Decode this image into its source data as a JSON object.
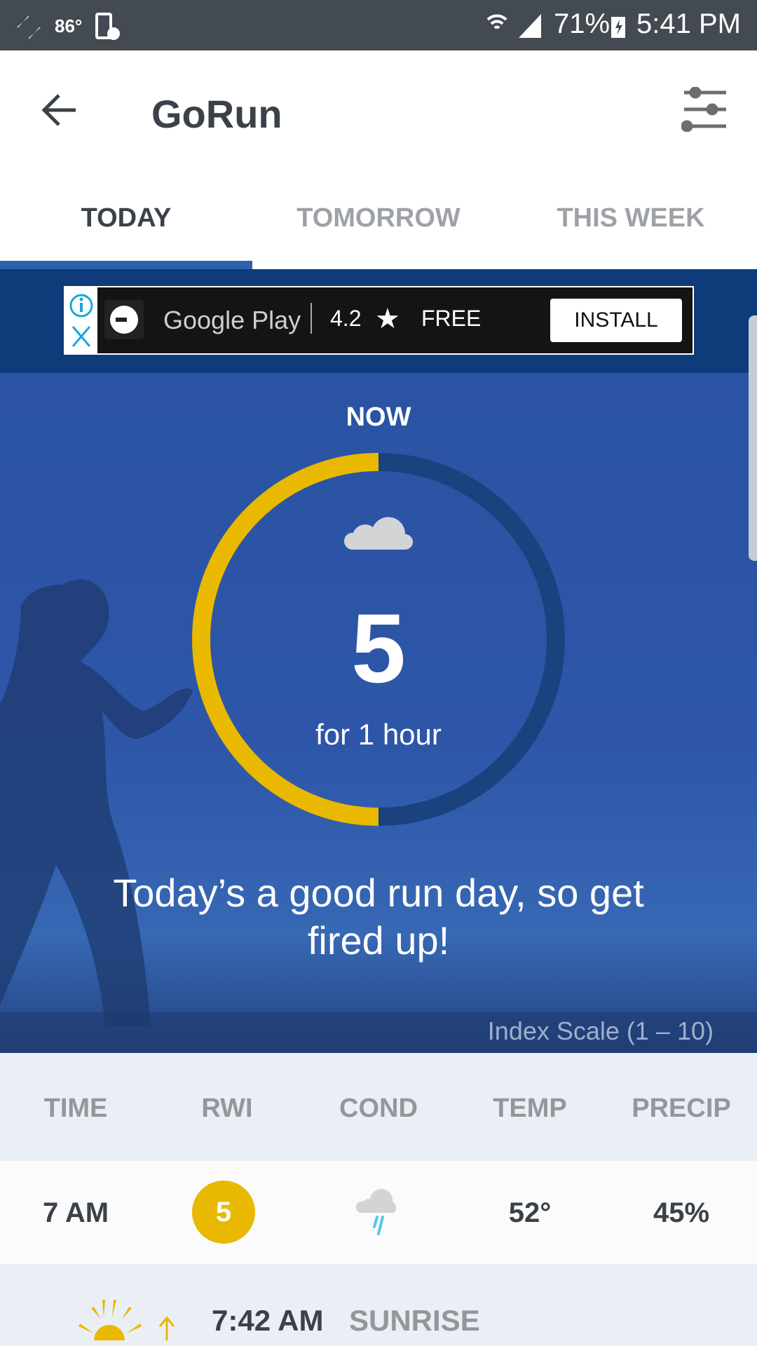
{
  "status_bar": {
    "temperature": "86°",
    "battery": "71%",
    "time": "5:41 PM"
  },
  "app_bar": {
    "title": "GoRun",
    "back_icon": "arrow-left-icon",
    "filter_icon": "sliders-icon"
  },
  "tabs": [
    {
      "label": "TODAY",
      "active": true
    },
    {
      "label": "TOMORROW",
      "active": false
    },
    {
      "label": "THIS WEEK",
      "active": false
    }
  ],
  "ad": {
    "store": "Google Play",
    "rating": "4.2",
    "price": "FREE",
    "install_label": "INSTALL"
  },
  "now": {
    "label": "NOW",
    "index": "5",
    "duration": "for 1 hour",
    "index_fraction": 0.5,
    "condition_icon": "cloud-icon",
    "message": "Today’s a good run day, so get fired up!",
    "scale_note": "Index Scale (1 – 10)"
  },
  "colors": {
    "accent": "#e9b800",
    "tab_indicator": "#2b62ad",
    "ring_track": "#1a427f"
  },
  "table": {
    "headers": [
      "TIME",
      "RWI",
      "COND",
      "TEMP",
      "PRECIP"
    ],
    "rows": [
      {
        "time": "7 AM",
        "rwi": "5",
        "cond": "rain-cloud-icon",
        "temp": "52°",
        "precip": "45%"
      }
    ]
  },
  "sunrise": {
    "time": "7:42 AM",
    "label": "SUNRISE"
  }
}
